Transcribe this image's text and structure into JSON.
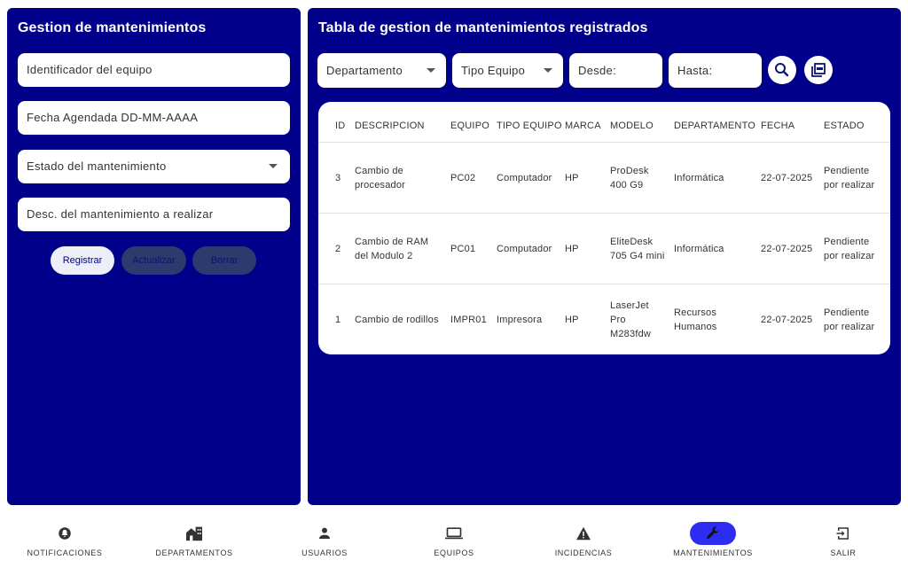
{
  "form": {
    "title": "Gestion de mantenimientos",
    "equipo_placeholder": "Identificador del equipo",
    "fecha_placeholder": "Fecha Agendada DD-MM-AAAA",
    "estado_placeholder": "Estado del mantenimiento",
    "desc_placeholder": "Desc. del mantenimiento a realizar",
    "registrar_label": "Registrar",
    "actualizar_label": "Actualizar",
    "borrar_label": "Borrar"
  },
  "table_panel": {
    "title": "Tabla de gestion de mantenimientos registrados",
    "filters": {
      "departamento": "Departamento",
      "tipo_equipo": "Tipo Equipo",
      "desde": "Desde:",
      "hasta": "Hasta:"
    },
    "columns": [
      "ID",
      "DESCRIPCION",
      "EQUIPO",
      "TIPO EQUIPO",
      "MARCA",
      "MODELO",
      "DEPARTAMENTO",
      "FECHA",
      "ESTADO"
    ],
    "rows": [
      {
        "id": "3",
        "descripcion": "Cambio de procesador",
        "equipo": "PC02",
        "tipo": "Computador",
        "marca": "HP",
        "modelo": "ProDesk 400 G9",
        "departamento": "Informática",
        "fecha": "22-07-2025",
        "estado": "Pendiente por realizar"
      },
      {
        "id": "2",
        "descripcion": "Cambio de RAM del Modulo 2",
        "equipo": "PC01",
        "tipo": "Computador",
        "marca": "HP",
        "modelo": "EliteDesk 705 G4 mini",
        "departamento": "Informática",
        "fecha": "22-07-2025",
        "estado": "Pendiente por realizar"
      },
      {
        "id": "1",
        "descripcion": "Cambio de rodillos",
        "equipo": "IMPR01",
        "tipo": "Impresora",
        "marca": "HP",
        "modelo": "LaserJet Pro M283fdw",
        "departamento": "Recursos Humanos",
        "fecha": "22-07-2025",
        "estado": "Pendiente por realizar"
      }
    ]
  },
  "nav": [
    {
      "label": "NOTIFICACIONES",
      "icon": "bell-icon"
    },
    {
      "label": "DEPARTAMENTOS",
      "icon": "buildings-icon"
    },
    {
      "label": "USUARIOS",
      "icon": "person-icon"
    },
    {
      "label": "EQUIPOS",
      "icon": "laptop-icon"
    },
    {
      "label": "INCIDENCIAS",
      "icon": "warning-icon"
    },
    {
      "label": "MANTENIMIENTOS",
      "icon": "wrench-icon",
      "active": true
    },
    {
      "label": "SALIR",
      "icon": "logout-icon"
    }
  ],
  "colors": {
    "panel_bg": "#00008b",
    "active_nav": "#2d2df2",
    "disabled_button": "#2d3a6e"
  }
}
